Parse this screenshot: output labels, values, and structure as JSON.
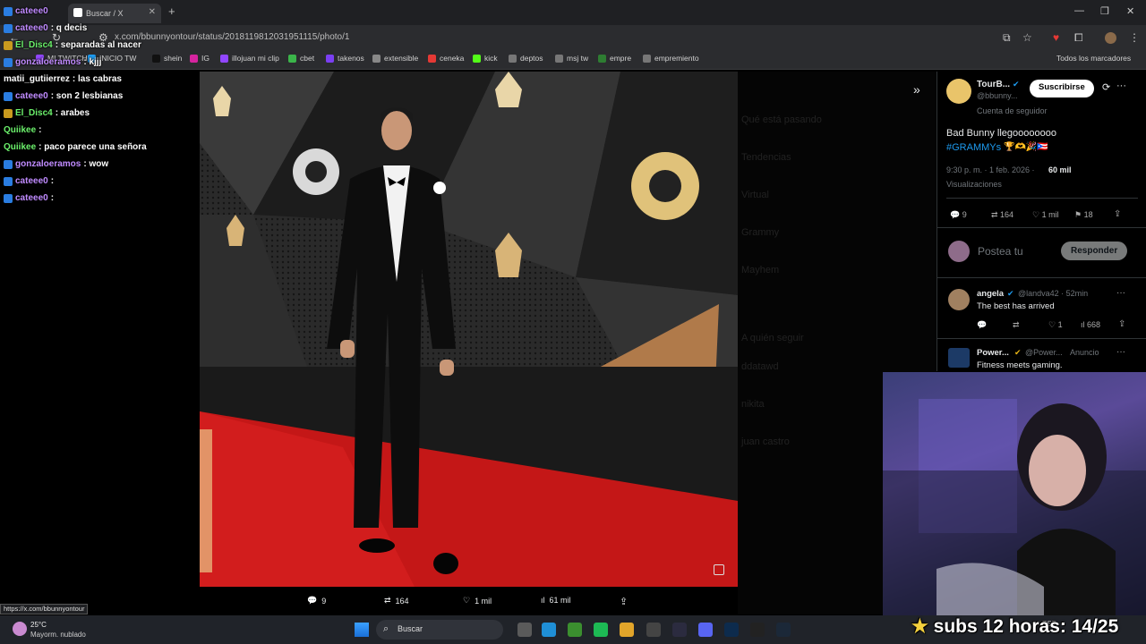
{
  "browser": {
    "tab_title": "Buscar / X",
    "url": "x.com/bbunnyontour/status/2018119812031951115/photo/1",
    "bookmarks": [
      {
        "label": "MI TWITCH",
        "color": "#9146ff"
      },
      {
        "label": "INICIO TW",
        "color": "#1d9bf0"
      },
      {
        "label": "shein",
        "color": "#111111"
      },
      {
        "label": "IG",
        "color": "#d6249f"
      },
      {
        "label": "illojuan mi clip",
        "color": "#9146ff"
      },
      {
        "label": "cbet",
        "color": "#3bb54a"
      },
      {
        "label": "takenos",
        "color": "#7b3ff2"
      },
      {
        "label": "extensible",
        "color": "#888888"
      },
      {
        "label": "ceneka",
        "color": "#e53935"
      },
      {
        "label": "kick",
        "color": "#53fc18"
      },
      {
        "label": "deptos",
        "color": "#777777"
      },
      {
        "label": "msj tw",
        "color": "#777777"
      },
      {
        "label": "empre",
        "color": "#2e7d32"
      },
      {
        "label": "empremiento",
        "color": "#777777"
      }
    ],
    "all_bookmarks": "Todos los marcadores"
  },
  "chat": [
    {
      "user": "cateee0",
      "msg": "",
      "color": "u-purple",
      "badge": "#2a7de1"
    },
    {
      "user": "cateee0",
      "msg": ": q decis",
      "color": "u-purple",
      "badge": "#2a7de1"
    },
    {
      "user": "El_Disc4",
      "msg": ": separadas al nacer",
      "color": "u-green",
      "badge": "#c99a1e"
    },
    {
      "user": "gonzaloeramos",
      "msg": ": kjjj",
      "color": "u-purple",
      "badge": "#2a7de1"
    },
    {
      "user": "matii_gutiierrez",
      "msg": ": las cabras",
      "color": "u-white",
      "badge": ""
    },
    {
      "user": "cateee0",
      "msg": ": son 2 lesbianas",
      "color": "u-purple",
      "badge": "#2a7de1"
    },
    {
      "user": "El_Disc4",
      "msg": ": arabes",
      "color": "u-green",
      "badge": "#c99a1e"
    },
    {
      "user": "Quiikee",
      "msg": ":",
      "color": "u-green",
      "badge": ""
    },
    {
      "user": "Quiikee",
      "msg": ": paco parece una señora",
      "color": "u-green",
      "badge": ""
    },
    {
      "user": "gonzaloeramos",
      "msg": ": wow",
      "color": "u-purple",
      "badge": "#2a7de1"
    },
    {
      "user": "cateee0",
      "msg": ":",
      "color": "u-purple",
      "badge": "#2a7de1"
    },
    {
      "user": "cateee0",
      "msg": ":",
      "color": "u-purple",
      "badge": "#2a7de1"
    }
  ],
  "sidebar_ghost": [
    "Qué está pasando",
    "Tendencias",
    "Virtual",
    "Grammy",
    "Mayhem",
    "A quién seguir",
    "ddatawd",
    "nikita",
    "juan castro"
  ],
  "tweet": {
    "author_name": "TourB...",
    "author_handle": "@bbunny...",
    "subscribe_label": "Suscribirse",
    "follower_note": "Cuenta de seguidor",
    "text_line1": "Bad Bunny llegoooooooo",
    "hashtag": "#GRAMMYs",
    "emoji": "🏆🫶🎉🇵🇷",
    "time": "9:30 p. m. · 1 feb. 2026 · ",
    "views_count": "60 mil",
    "views_label": "Visualizaciones",
    "replies": "9",
    "retweets": "164",
    "likes": "1 mil",
    "bookmarks": "18",
    "reply_placeholder": "Postea tu",
    "reply_button": "Responder"
  },
  "reply": {
    "name": "angela",
    "handle": "@landva42 · 52min",
    "text": "The best has arrived",
    "likes": "1",
    "views": "668"
  },
  "ad": {
    "name": "Power...",
    "handle": "@Power...",
    "label": "Anuncio",
    "text": "Fitness meets gaming."
  },
  "photo_actions": {
    "replies": "9",
    "retweets": "164",
    "likes": "1 mil",
    "views": "61 mil"
  },
  "status_url": "https://x.com/bbunnyontour",
  "taskbar": {
    "temp": "25°C",
    "weather": "Mayorm. nublado",
    "search": "Buscar",
    "lang": "ESP"
  },
  "overlay_subs": "subs 12 horas: 14/25"
}
